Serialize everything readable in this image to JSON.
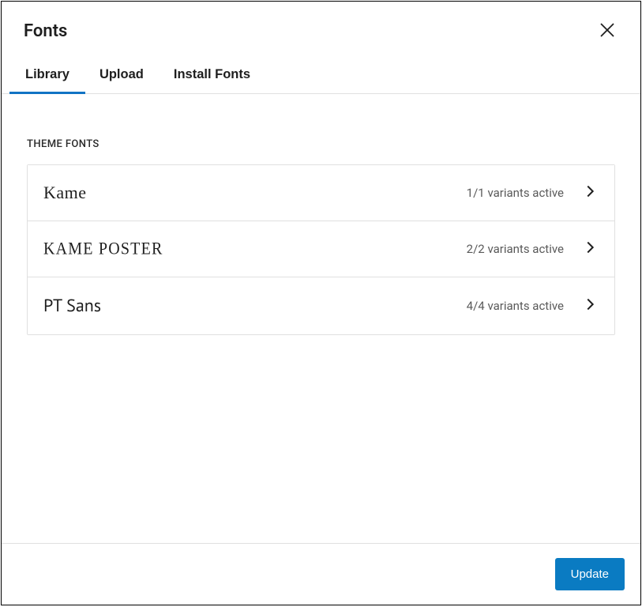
{
  "header": {
    "title": "Fonts"
  },
  "tabs": {
    "library": "Library",
    "upload": "Upload",
    "install": "Install Fonts"
  },
  "section": {
    "label": "THEME FONTS"
  },
  "fonts": [
    {
      "name": "Kame",
      "variants": "1/1 variants active"
    },
    {
      "name": "KAME POSTER",
      "variants": "2/2 variants active"
    },
    {
      "name": "PT Sans",
      "variants": "4/4 variants active"
    }
  ],
  "footer": {
    "update": "Update"
  }
}
